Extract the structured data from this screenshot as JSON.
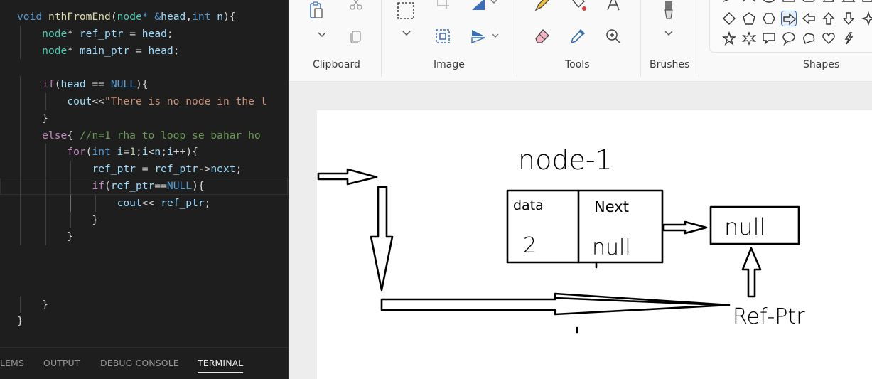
{
  "editor": {
    "lines": [
      [
        [
          "t-kw",
          "void"
        ],
        [
          "t-pl",
          " "
        ],
        [
          "t-fn",
          "nthFromEnd"
        ],
        [
          "t-pl",
          "("
        ],
        [
          "t-type",
          "node"
        ],
        [
          "t-kw",
          "*"
        ],
        [
          "t-pl",
          " "
        ],
        [
          "t-kw",
          "&"
        ],
        [
          "t-var",
          "head"
        ],
        [
          "t-pl",
          ","
        ],
        [
          "t-kw",
          "int"
        ],
        [
          "t-pl",
          " "
        ],
        [
          "t-var",
          "n"
        ],
        [
          "t-pl",
          "){"
        ]
      ],
      [
        [
          "t-pl",
          "    "
        ],
        [
          "t-type",
          "node"
        ],
        [
          "t-pl",
          "* "
        ],
        [
          "t-var",
          "ref_ptr"
        ],
        [
          "t-pl",
          " = "
        ],
        [
          "t-var",
          "head"
        ],
        [
          "t-pl",
          ";"
        ]
      ],
      [
        [
          "t-pl",
          "    "
        ],
        [
          "t-type",
          "node"
        ],
        [
          "t-pl",
          "* "
        ],
        [
          "t-var",
          "main_ptr"
        ],
        [
          "t-pl",
          " = "
        ],
        [
          "t-var",
          "head"
        ],
        [
          "t-pl",
          ";"
        ]
      ],
      [],
      [
        [
          "t-pl",
          "    "
        ],
        [
          "t-ctl",
          "if"
        ],
        [
          "t-pl",
          "("
        ],
        [
          "t-var",
          "head"
        ],
        [
          "t-pl",
          " == "
        ],
        [
          "t-kw",
          "NULL"
        ],
        [
          "t-pl",
          "){"
        ]
      ],
      [
        [
          "t-pl",
          "        "
        ],
        [
          "t-var",
          "cout"
        ],
        [
          "t-pl",
          "<<"
        ],
        [
          "t-str",
          "\"There is no node in the l"
        ]
      ],
      [
        [
          "t-pl",
          "    }"
        ]
      ],
      [
        [
          "t-pl",
          "    "
        ],
        [
          "t-ctl",
          "else"
        ],
        [
          "t-pl",
          "{ "
        ],
        [
          "t-com",
          "//n=1 rha to loop se bahar ho"
        ]
      ],
      [
        [
          "t-pl",
          "        "
        ],
        [
          "t-ctl",
          "for"
        ],
        [
          "t-pl",
          "("
        ],
        [
          "t-kw",
          "int"
        ],
        [
          "t-pl",
          " "
        ],
        [
          "t-var",
          "i"
        ],
        [
          "t-pl",
          "="
        ],
        [
          "t-num",
          "1"
        ],
        [
          "t-pl",
          ";"
        ],
        [
          "t-var",
          "i"
        ],
        [
          "t-pl",
          "<"
        ],
        [
          "t-var",
          "n"
        ],
        [
          "t-pl",
          ";"
        ],
        [
          "t-var",
          "i"
        ],
        [
          "t-pl",
          "++){"
        ]
      ],
      [
        [
          "t-pl",
          "            "
        ],
        [
          "t-var",
          "ref_ptr"
        ],
        [
          "t-pl",
          " = "
        ],
        [
          "t-var",
          "ref_ptr"
        ],
        [
          "t-pl",
          "->"
        ],
        [
          "t-var",
          "next"
        ],
        [
          "t-pl",
          ";"
        ]
      ],
      [
        [
          "t-pl",
          "            "
        ],
        [
          "t-ctl",
          "if"
        ],
        [
          "t-pl",
          "("
        ],
        [
          "t-var",
          "ref_ptr"
        ],
        [
          "t-pl",
          "=="
        ],
        [
          "t-kw",
          "NULL"
        ],
        [
          "t-pl",
          "){"
        ]
      ],
      [
        [
          "t-pl",
          "                "
        ],
        [
          "t-var",
          "cout"
        ],
        [
          "t-pl",
          "<< "
        ],
        [
          "t-var",
          "ref_ptr"
        ],
        [
          "t-pl",
          ";"
        ]
      ],
      [
        [
          "t-pl",
          "            }"
        ]
      ],
      [
        [
          "t-pl",
          "        }"
        ]
      ],
      [],
      [],
      [],
      [
        [
          "t-pl",
          "    }"
        ]
      ],
      [
        [
          "t-pl",
          "}"
        ]
      ]
    ],
    "current_line": 10
  },
  "panel": {
    "tabs": [
      "LEMS",
      "OUTPUT",
      "DEBUG CONSOLE",
      "TERMINAL"
    ],
    "active": "TERMINAL"
  },
  "paint": {
    "groups": {
      "clipboard": "Clipboard",
      "image": "Image",
      "tools": "Tools",
      "brushes": "Brushes",
      "shapes": "Shapes"
    },
    "canvas_text": {
      "title": "node-1",
      "data_label": "data",
      "data_value": "2",
      "next_label": "Next",
      "next_value": "null",
      "null_box": "null",
      "pointer_label": "Ref-Ptr"
    }
  }
}
